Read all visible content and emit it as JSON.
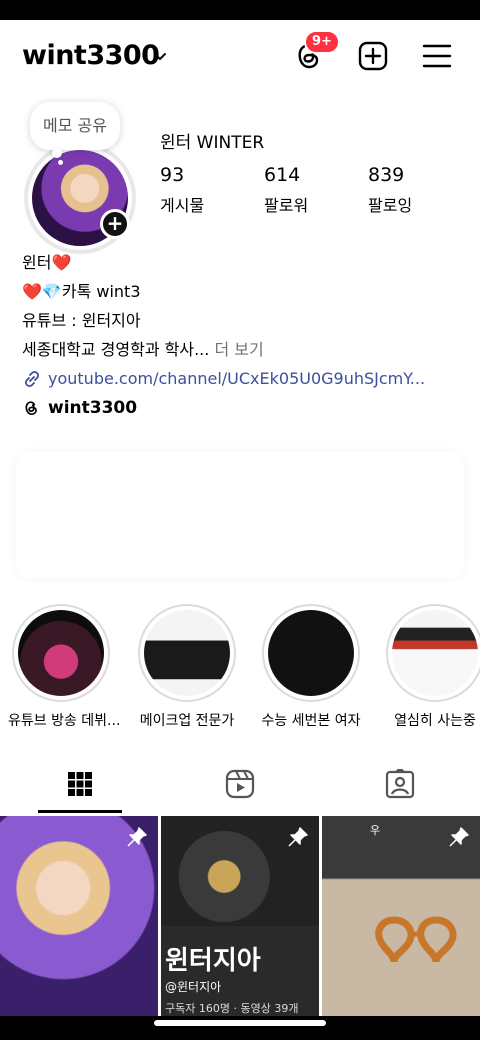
{
  "header": {
    "username": "wint3300",
    "notification_badge": "9+",
    "icons": [
      "threads-icon",
      "add-post-icon",
      "menu-icon"
    ]
  },
  "note": {
    "label": "메모 공유"
  },
  "profile": {
    "display_name": "윈터 WINTER",
    "stats": [
      {
        "value": "93",
        "label": "게시물"
      },
      {
        "value": "614",
        "label": "팔로워"
      },
      {
        "value": "839",
        "label": "팔로잉"
      }
    ]
  },
  "bio": {
    "line1": "윈터❤️",
    "line2": "❤️💎카톡 wint3",
    "line3": "유튜브 : 윈터지아",
    "line4": "세종대학교 경영학과 학사...",
    "more": " 더 보기",
    "link": "youtube.com/channel/UCxEk05U0G9uhSJcmY...",
    "threads_handle": "wint3300"
  },
  "highlights": [
    {
      "label": "유튜브 방송 데뷔..."
    },
    {
      "label": "메이크업 전문가"
    },
    {
      "label": "수능 세번본 여자"
    },
    {
      "label": "열심히 사는중"
    }
  ],
  "tabs": [
    "posts-grid",
    "reels",
    "tagged"
  ],
  "grid": {
    "post2": {
      "title": "윈터지아",
      "handle": "@윈터지아",
      "meta": "구독자 160명 · 동영상 39개"
    },
    "post3": {
      "tag": "우"
    }
  },
  "colors": {
    "badge": "#ff3040",
    "link": "#3b4fa0",
    "muted": "#737373"
  }
}
